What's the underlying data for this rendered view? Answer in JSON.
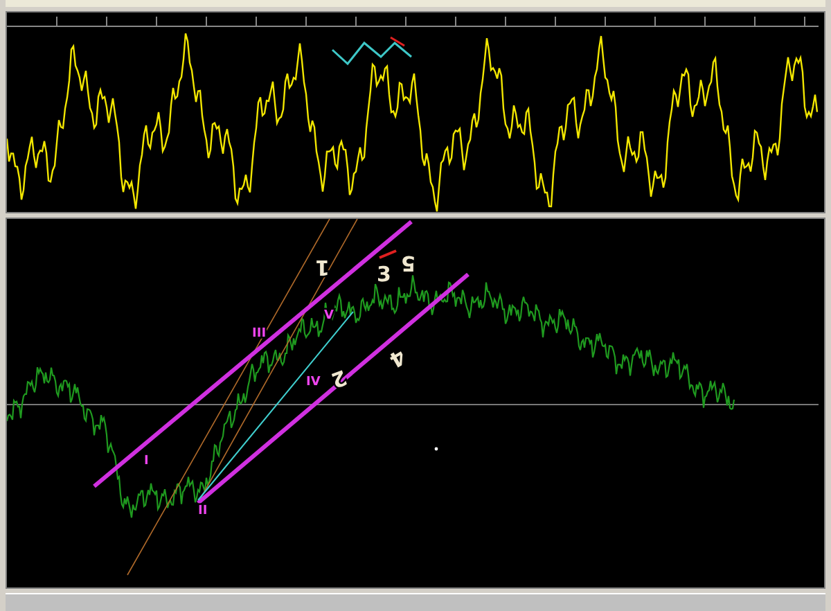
{
  "oscillator_panel": {
    "markers": [
      {
        "kind": "zigzag",
        "color": "#3ec8c8"
      },
      {
        "kind": "segment",
        "color": "#e02020"
      }
    ]
  },
  "price_panel": {
    "wave_labels": [
      {
        "text": "I",
        "kind": "roman"
      },
      {
        "text": "II",
        "kind": "roman"
      },
      {
        "text": "III",
        "kind": "roman"
      },
      {
        "text": "IV",
        "kind": "roman"
      },
      {
        "text": "V",
        "kind": "roman"
      },
      {
        "text": "1",
        "kind": "digit"
      },
      {
        "text": "2",
        "kind": "digit"
      },
      {
        "text": "3",
        "kind": "digit"
      },
      {
        "text": "4",
        "kind": "digit"
      },
      {
        "text": "5",
        "kind": "digit"
      }
    ]
  }
}
